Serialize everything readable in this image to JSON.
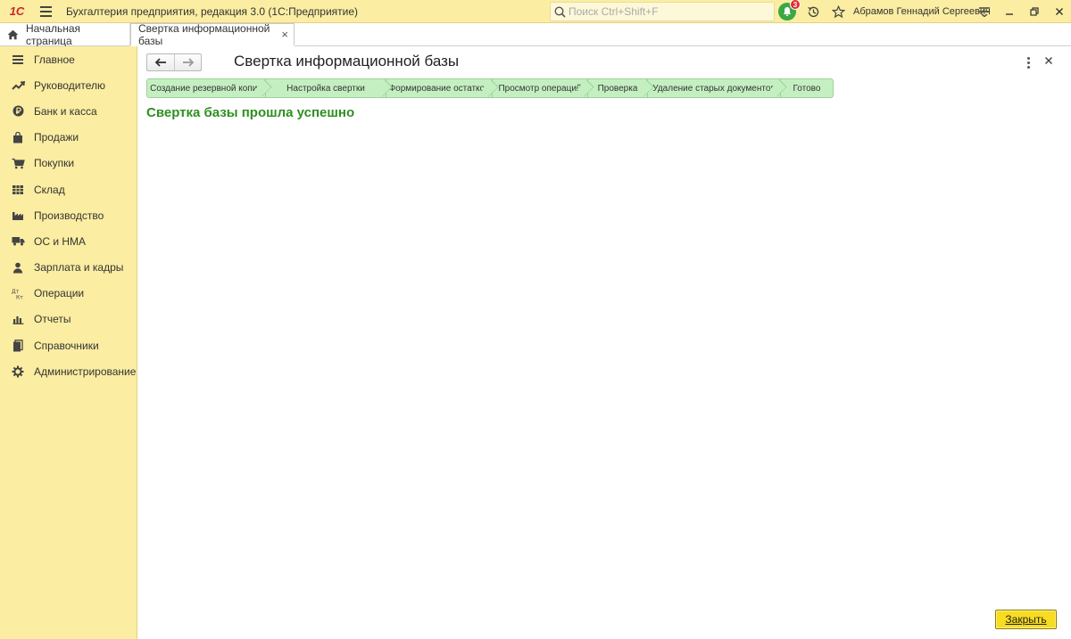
{
  "titlebar": {
    "logo": "1С",
    "app_title": "Бухгалтерия предприятия, редакция 3.0  (1С:Предприятие)",
    "search_placeholder": "Поиск Ctrl+Shift+F",
    "notifications_count": "3",
    "user_name": "Абрамов Геннадий Сергеевич"
  },
  "tabs": {
    "home_label": "Начальная страница",
    "active_label": "Свертка информационной базы",
    "close_glyph": "×"
  },
  "sidebar": {
    "items": [
      {
        "label": "Главное",
        "icon": "menu-lines-icon"
      },
      {
        "label": "Руководителю",
        "icon": "trend-up-icon"
      },
      {
        "label": "Банк и касса",
        "icon": "ruble-coin-icon"
      },
      {
        "label": "Продажи",
        "icon": "shopping-bag-icon"
      },
      {
        "label": "Покупки",
        "icon": "cart-icon"
      },
      {
        "label": "Склад",
        "icon": "warehouse-grid-icon"
      },
      {
        "label": "Производство",
        "icon": "factory-icon"
      },
      {
        "label": "ОС и НМА",
        "icon": "truck-icon"
      },
      {
        "label": "Зарплата и кадры",
        "icon": "person-icon"
      },
      {
        "label": "Операции",
        "icon": "dt-kt-icon"
      },
      {
        "label": "Отчеты",
        "icon": "bar-chart-icon"
      },
      {
        "label": "Справочники",
        "icon": "books-icon"
      },
      {
        "label": "Администрирование",
        "icon": "gear-icon"
      }
    ]
  },
  "main": {
    "title": "Свертка информационной базы",
    "steps": [
      "Создание резервной копии",
      "Настройка свертки",
      "Формирование остатков",
      "Просмотр операций",
      "Проверка",
      "Удаление старых документов",
      "Готово"
    ],
    "result_text": "Свертка базы прошла успешно",
    "close_button_label": "Закрыть"
  },
  "colors": {
    "panel_yellow": "#fbeda1",
    "step_green": "#c4f0c1",
    "success_green": "#2e8f20",
    "button_yellow": "#f7dc1f"
  }
}
